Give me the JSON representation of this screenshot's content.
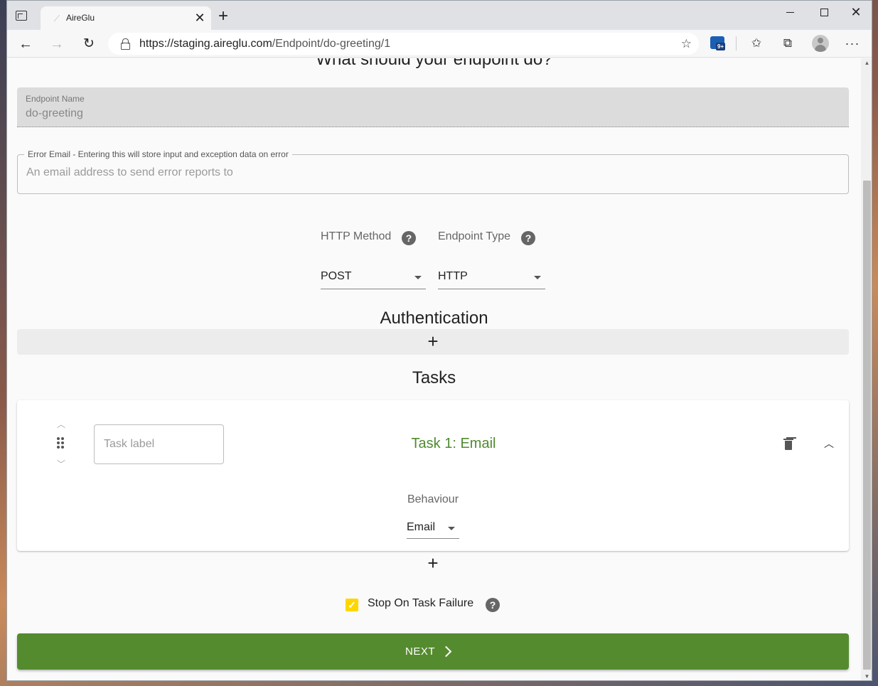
{
  "browser": {
    "tab_title": "AireGlu",
    "tab_close": "✕",
    "new_tab": "+",
    "url_host": "https://staging.aireglu.com",
    "url_path": "/Endpoint/do-greeting/1",
    "extension_badge": "9+",
    "more_menu": "···"
  },
  "page": {
    "heading": "What should your endpoint do?",
    "endpoint_name": {
      "label": "Endpoint Name",
      "value": "do-greeting"
    },
    "error_email": {
      "label": "Error Email - Entering this will store input and exception data on error",
      "placeholder": "An email address to send error reports to"
    },
    "http_method": {
      "label": "HTTP Method",
      "value": "POST"
    },
    "endpoint_type": {
      "label": "Endpoint Type",
      "value": "HTTP"
    },
    "help_glyph": "?",
    "authentication_title": "Authentication",
    "add_glyph": "+",
    "tasks_title": "Tasks",
    "task": {
      "label_placeholder": "Task label",
      "title": "Task 1: Email",
      "behaviour_label": "Behaviour",
      "behaviour_value": "Email"
    },
    "stop_on_failure": {
      "label": "Stop On Task Failure",
      "checked": true
    },
    "next_label": "NEXT"
  },
  "colors": {
    "accent_green": "#558b2f",
    "task_title_green": "#4f8a2f",
    "checkbox_yellow": "#ffd600"
  }
}
